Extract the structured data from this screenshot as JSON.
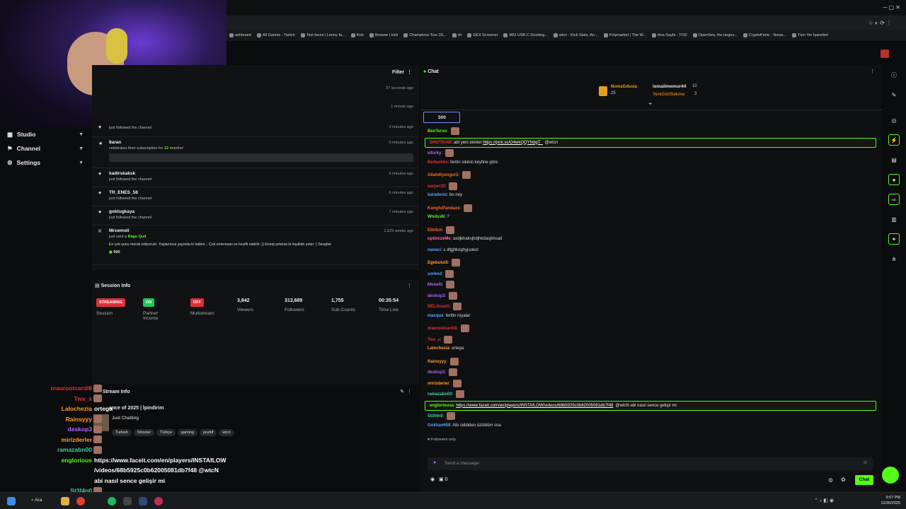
{
  "browser": {
    "bookmarks": [
      "ashboard",
      "All Games - Twitch",
      "Text faces | Lenny fa...",
      "Kick",
      "Browse | kick",
      "Champions Tour 20...",
      "vlr",
      "DEX Screener",
      "MSI USB-C Docking...",
      "wtcn - Kick Stats, An...",
      "Polymarket | The W...",
      "Ana Sayfa - TOD",
      "OpenSea, the larges...",
      "CryptoPanic - News...",
      "Tüm Yer İşaretleri"
    ]
  },
  "leftnav": [
    {
      "label": "Studio",
      "icon": "studio-icon"
    },
    {
      "label": "Channel",
      "icon": "channel-icon"
    },
    {
      "label": "Settings",
      "icon": "settings-icon"
    }
  ],
  "activity": {
    "filter_label": "Filter",
    "times_top": [
      "37 seconds ago",
      "1 minute ago"
    ],
    "items": [
      {
        "name": "",
        "sub": "just followed the channel",
        "time": "2 minutes ago"
      },
      {
        "name": "8aran",
        "sub": "celebrates their subscription for",
        "months": "12",
        "months_suffix": "months!",
        "time": "5 minutes ago"
      },
      {
        "name": "kadirskaksk",
        "sub": "just followed the channel",
        "time": "6 minutes ago"
      },
      {
        "name": "TR_ENES_58",
        "sub": "just followed the channel",
        "time": "6 minutes ago"
      },
      {
        "name": "goktugkaya",
        "sub": "just followed the channel",
        "time": "7 minutes ago"
      },
      {
        "name": "Mrcemoli",
        "sub": "just sent a",
        "gift": "Rage Quit",
        "time": "1,929 weeks ago",
        "message": "En çok şunu merak ediyorum. Yaşlanınca yayında ki halleri... Çok enteresan ve keyifli olabilir :)) Enerji yeterse ki inşallah yeter :) Sevgiler",
        "amount": "500"
      }
    ]
  },
  "session": {
    "title": "Session Info",
    "streaming_badge": "STREAMING",
    "streaming_label": "Session",
    "partner_badge": "ON",
    "partner_label": "Partner Income",
    "multi_badge": "OFF",
    "multi_label": "Multistream",
    "viewers": "3,842",
    "viewers_label": "Viewers",
    "followers": "313,689",
    "followers_label": "Followers",
    "subs": "1,755",
    "subs_label": "Sub Counts",
    "time": "00:35:54",
    "time_label": "Time Live"
  },
  "stream_info": {
    "title": "Stream Info",
    "stream_title": "ance of 2025 | İpindirim",
    "category": "Just Chatting",
    "tags": [
      "Turkish",
      "Shooter",
      "Türkçe",
      "gaming",
      "pozitif",
      "wtcn"
    ]
  },
  "overlay_chat": [
    {
      "name": "mauroolcardi8",
      "color": "#e0303a"
    },
    {
      "name": "Twx_x",
      "color": "#e0303a"
    },
    {
      "name": "Lalochezia",
      "color": "#ff9a2a",
      "text": "ortega"
    },
    {
      "name": "Rainsyyy",
      "color": "#ff9a2a"
    },
    {
      "name": "deskop3",
      "color": "#b064ff"
    },
    {
      "name": "mirizderler",
      "color": "#ff9a2a"
    },
    {
      "name": "ramazabn00",
      "color": "#3fd0a0"
    },
    {
      "name": "englorious",
      "color": "#53fc18",
      "text": "https://www.faceit.com/en/players/INSTAfLOW"
    },
    {
      "name": "",
      "color": "#fff",
      "text": "/videos/68b5925c0b62005081db7f48 @wtcN"
    },
    {
      "name": "",
      "color": "#fff",
      "text": "abi nasıl sence gelişir mi"
    },
    {
      "name": "St3f4n0",
      "color": "#3fd0a0"
    }
  ],
  "chat": {
    "title": "Chat",
    "top_gifters": [
      {
        "name": "NomaGdusia",
        "count": "25"
      },
      {
        "name": "ismailmemur44",
        "count": "10"
      },
      {
        "name": "YeniGizliSekme",
        "count": "3"
      }
    ],
    "pinned_amount": "500",
    "messages": [
      {
        "user": "BenTerso",
        "color": "#53fc18",
        "text": ""
      },
      {
        "user": "SHOTRAW",
        "color": "#e0303a",
        "text": "abi yeni skinler",
        "link": "https://prnt.sc/O4wkQQYNdgT_",
        "after": "@wtcn",
        "highlight": true
      },
      {
        "user": "wfurky",
        "color": "#b064ff",
        "text": ""
      },
      {
        "user": "Bedaoktie",
        "color": "#e0303a",
        "text": "feritin sikinin keyfine göre"
      },
      {
        "user": "Allahdiyengorii",
        "color": "#ff6a2a",
        "text": ""
      },
      {
        "user": "sarper20",
        "color": "#e0303a",
        "text": ""
      },
      {
        "user": "karadeniz",
        "color": "#5aa0ff",
        "text": "bu ney"
      },
      {
        "user": "KungfuPandaxx",
        "color": "#ff6a2a",
        "text": ""
      },
      {
        "user": "WndssN",
        "color": "#53fc18",
        "text": "?"
      },
      {
        "user": "Eltritch",
        "color": "#ff6a2a",
        "text": ""
      },
      {
        "user": "optimizeMe",
        "color": "#ff6aa0",
        "text": "asdjkhaksjhdjhkdasjkhsad"
      },
      {
        "user": "naneci",
        "color": "#5aa0ff",
        "text": "s dfgjhkoghyjuokol"
      },
      {
        "user": "Egebulut5",
        "color": "#ff9a2a",
        "text": ""
      },
      {
        "user": "sorknd",
        "color": "#5aa0ff",
        "text": ""
      },
      {
        "user": "Museib",
        "color": "#b064ff",
        "text": ""
      },
      {
        "user": "deskop3",
        "color": "#b064ff",
        "text": ""
      },
      {
        "user": "MELihsar0",
        "color": "#e0303a",
        "text": ""
      },
      {
        "user": "eiacqua",
        "color": "#5aa0ff",
        "text": "feritin rüyalar"
      },
      {
        "user": "mauroolcardi8",
        "color": "#e0303a",
        "text": ""
      },
      {
        "user": "Twx_x",
        "color": "#e0303a",
        "text": ""
      },
      {
        "user": "Lalochezia",
        "color": "#ff9a2a",
        "text": "ortega"
      },
      {
        "user": "Rainsyyy",
        "color": "#ff9a2a",
        "text": ""
      },
      {
        "user": "deskop3",
        "color": "#b064ff",
        "text": ""
      },
      {
        "user": "mirizderler",
        "color": "#ff9a2a",
        "text": ""
      },
      {
        "user": "ramazabn00",
        "color": "#3fd0a0",
        "text": ""
      },
      {
        "user": "engloriousa",
        "color": "#53fc18",
        "text": "",
        "link": "https://www.faceit.com/en/players/INSTAfLOW/videos/68b5925c0b62005081db7f48",
        "after": "@wtcN abi nasıl sence gelişir mi",
        "highlight": true
      },
      {
        "user": "St3f4n0",
        "color": "#3fd0a0",
        "text": ""
      },
      {
        "user": "Gokhan658",
        "color": "#5aa0ff",
        "text": "Abi ciddiden üzüldüm sna"
      }
    ],
    "followers_only": "Followers only",
    "input_placeholder": "Send a message",
    "points": "0",
    "send_label": "Chat"
  },
  "taskbar": {
    "search_label": "Ara",
    "time": "9:57 PM",
    "date": "12/30/2025"
  }
}
